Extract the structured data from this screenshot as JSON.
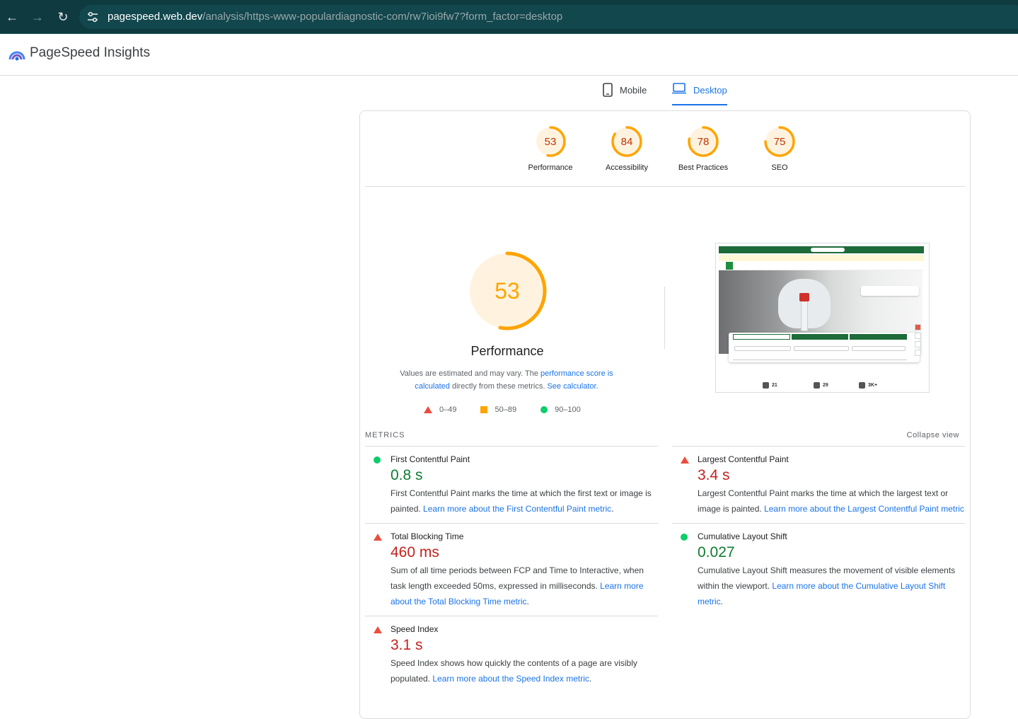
{
  "browser": {
    "url_host": "pagespeed.web.dev",
    "url_path": "/analysis/https-www-populardiagnostic-com/rw7ioi9fw7?form_factor=desktop",
    "icons": [
      "back-arrow-icon",
      "forward-arrow-icon",
      "reload-icon",
      "site-settings-icon"
    ]
  },
  "header": {
    "app_title": "PageSpeed Insights"
  },
  "tabs": [
    {
      "label": "Mobile",
      "icon": "phone-icon",
      "selected": false
    },
    {
      "label": "Desktop",
      "icon": "laptop-icon",
      "selected": true
    }
  ],
  "scores": [
    {
      "label": "Performance",
      "value": "53",
      "fraction": 0.53
    },
    {
      "label": "Accessibility",
      "value": "84",
      "fraction": 0.84
    },
    {
      "label": "Best Practices",
      "value": "78",
      "fraction": 0.78
    },
    {
      "label": "SEO",
      "value": "75",
      "fraction": 0.75
    }
  ],
  "colors": {
    "average": "#ffa400",
    "average_bg": "#fff3e0",
    "average_text": "#c33300",
    "fail": "#eb4d3d",
    "pass": "#0cce6b",
    "link": "#1a73e8"
  },
  "performance": {
    "score": "53",
    "fraction": 0.53,
    "title": "Performance",
    "note_prefix": "Values are estimated and may vary. The ",
    "note_link1": "performance score is calculated",
    "note_mid": " directly from these metrics. ",
    "note_link2": "See calculator."
  },
  "legend": [
    {
      "shape": "triangle",
      "label": "0–49"
    },
    {
      "shape": "square",
      "label": "50–89"
    },
    {
      "shape": "circle",
      "label": "90–100"
    }
  ],
  "screenshot": {
    "stats": [
      {
        "value": "21"
      },
      {
        "value": "29"
      },
      {
        "value": "3K+"
      }
    ]
  },
  "metrics_header": "METRICS",
  "collapse_label": "Collapse view",
  "metrics": {
    "fcp": {
      "name": "First Contentful Paint",
      "value": "0.8 s",
      "status": "pass",
      "desc": "First Contentful Paint marks the time at which the first text or image is painted. ",
      "link": "Learn more about the First Contentful Paint metric",
      "tail": "."
    },
    "lcp": {
      "name": "Largest Contentful Paint",
      "value": "3.4 s",
      "status": "fail",
      "desc": "Largest Contentful Paint marks the time at which the largest text or image is painted. ",
      "link": "Learn more about the Largest Contentful Paint metric",
      "tail": ""
    },
    "tbt": {
      "name": "Total Blocking Time",
      "value": "460 ms",
      "status": "fail",
      "desc": "Sum of all time periods between FCP and Time to Interactive, when task length exceeded 50ms, expressed in milliseconds. ",
      "link": "Learn more about the Total Blocking Time metric",
      "tail": "."
    },
    "cls": {
      "name": "Cumulative Layout Shift",
      "value": "0.027",
      "status": "pass",
      "desc": "Cumulative Layout Shift measures the movement of visible elements within the viewport. ",
      "link": "Learn more about the Cumulative Layout Shift metric",
      "tail": "."
    },
    "si": {
      "name": "Speed Index",
      "value": "3.1 s",
      "status": "fail",
      "desc": "Speed Index shows how quickly the contents of a page are visibly populated. ",
      "link": "Learn more about the Speed Index metric",
      "tail": "."
    }
  }
}
